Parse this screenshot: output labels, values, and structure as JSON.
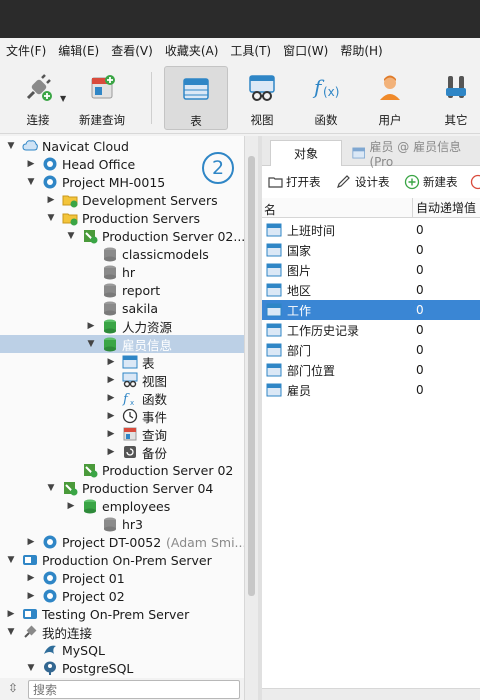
{
  "menu": [
    "文件(F)",
    "编辑(E)",
    "查看(V)",
    "收藏夹(A)",
    "工具(T)",
    "窗口(W)",
    "帮助(H)"
  ],
  "toolbar": {
    "connect": "连接",
    "new_query": "新建查询",
    "table": "表",
    "view": "视图",
    "function": "函数",
    "user": "用户",
    "other": "其它"
  },
  "tree": [
    {
      "label": "Navicat Cloud",
      "icon": "cloud-icon",
      "arrow": "down"
    },
    {
      "label": "Head Office",
      "icon": "project-icon",
      "arrow": "right"
    },
    {
      "label": "Project MH-0015",
      "icon": "project-icon",
      "arrow": "down"
    },
    {
      "label": "Development Servers",
      "icon": "folder-icon",
      "arrow": "right"
    },
    {
      "label": "Production Servers",
      "icon": "folder-icon",
      "arrow": "down"
    },
    {
      "label": "Production Server 02...",
      "icon": "server-icon",
      "arrow": "down"
    },
    {
      "label": "classicmodels",
      "icon": "database-icon",
      "arrow": ""
    },
    {
      "label": "hr",
      "icon": "database-icon",
      "arrow": ""
    },
    {
      "label": "report",
      "icon": "database-icon",
      "arrow": ""
    },
    {
      "label": "sakila",
      "icon": "database-icon",
      "arrow": ""
    },
    {
      "label": "人力资源",
      "icon": "database-open-icon",
      "arrow": "right"
    },
    {
      "label": "雇员信息",
      "icon": "database-open-icon",
      "arrow": "down"
    },
    {
      "label": "表",
      "icon": "table-icon",
      "arrow": "right"
    },
    {
      "label": "视图",
      "icon": "view-icon",
      "arrow": "right"
    },
    {
      "label": "函数",
      "icon": "function-icon",
      "arrow": "right"
    },
    {
      "label": "事件",
      "icon": "event-icon",
      "arrow": "right"
    },
    {
      "label": "查询",
      "icon": "query-icon",
      "arrow": "right"
    },
    {
      "label": "备份",
      "icon": "backup-icon",
      "arrow": "right"
    },
    {
      "label": "Production Server 02",
      "icon": "server-icon",
      "arrow": ""
    },
    {
      "label": "Production Server 04",
      "icon": "server-icon",
      "arrow": "down"
    },
    {
      "label": "employees",
      "icon": "database-open-icon",
      "arrow": "right"
    },
    {
      "label": "hr3",
      "icon": "database-icon",
      "arrow": ""
    },
    {
      "label": "Project DT-0052",
      "sublabel": "(Adam Smi...",
      "icon": "project-icon",
      "arrow": "right"
    },
    {
      "label": "Production On-Prem Server",
      "icon": "onprem-icon",
      "arrow": "down"
    },
    {
      "label": "Project 01",
      "icon": "project-icon",
      "arrow": "right"
    },
    {
      "label": "Project 02",
      "icon": "project-icon",
      "arrow": "right"
    },
    {
      "label": "Testing On-Prem Server",
      "icon": "onprem-icon",
      "arrow": "right"
    },
    {
      "label": "我的连接",
      "icon": "connection-icon",
      "arrow": "down"
    },
    {
      "label": "MySQL",
      "icon": "mysql-icon",
      "arrow": ""
    },
    {
      "label": "PostgreSQL",
      "icon": "postgresql-icon",
      "arrow": "down"
    }
  ],
  "badge": "2",
  "search": {
    "placeholder": "搜索"
  },
  "tabs": {
    "objects": "对象",
    "table_tab": "雇员 @ 雇员信息 (Pro"
  },
  "obj_toolbar": {
    "open": "打开表",
    "design": "设计表",
    "new": "新建表"
  },
  "grid": {
    "col_name": "名",
    "col_auto": "自动递增值",
    "rows": [
      {
        "name": "上班时间",
        "value": "0"
      },
      {
        "name": "国家",
        "value": "0"
      },
      {
        "name": "图片",
        "value": "0"
      },
      {
        "name": "地区",
        "value": "0"
      },
      {
        "name": "工作",
        "value": "0"
      },
      {
        "name": "工作历史记录",
        "value": "0"
      },
      {
        "name": "部门",
        "value": "0"
      },
      {
        "name": "部门位置",
        "value": "0"
      },
      {
        "name": "雇员",
        "value": "0"
      }
    ]
  },
  "colors": {
    "accent": "#3a86d4",
    "selection": "#bcd0e6",
    "badge": "#2f86c6"
  }
}
